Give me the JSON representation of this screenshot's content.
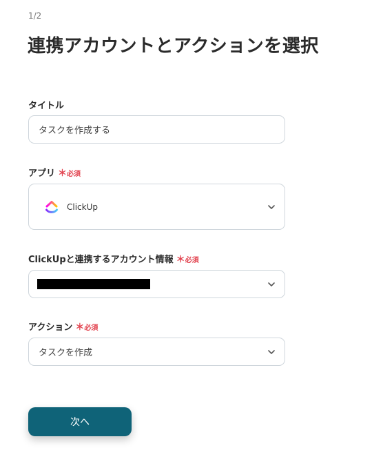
{
  "step_indicator": "1/2",
  "page_title": "連携アカウントとアクションを選択",
  "title_field": {
    "label": "タイトル",
    "value": "タスクを作成する"
  },
  "app_field": {
    "label": "アプリ",
    "required_star": "＊",
    "required_text": "必須",
    "selected_app": "ClickUp",
    "icon": "clickup-logo-icon"
  },
  "account_field": {
    "label": "ClickUpと連携するアカウント情報",
    "required_star": "＊",
    "required_text": "必須"
  },
  "action_field": {
    "label": "アクション",
    "required_star": "＊",
    "required_text": "必須",
    "selected": "タスクを作成"
  },
  "next_button": {
    "label": "次へ"
  },
  "colors": {
    "primary": "#0f6378",
    "required": "#e2434f",
    "border": "#cfd6dc"
  }
}
